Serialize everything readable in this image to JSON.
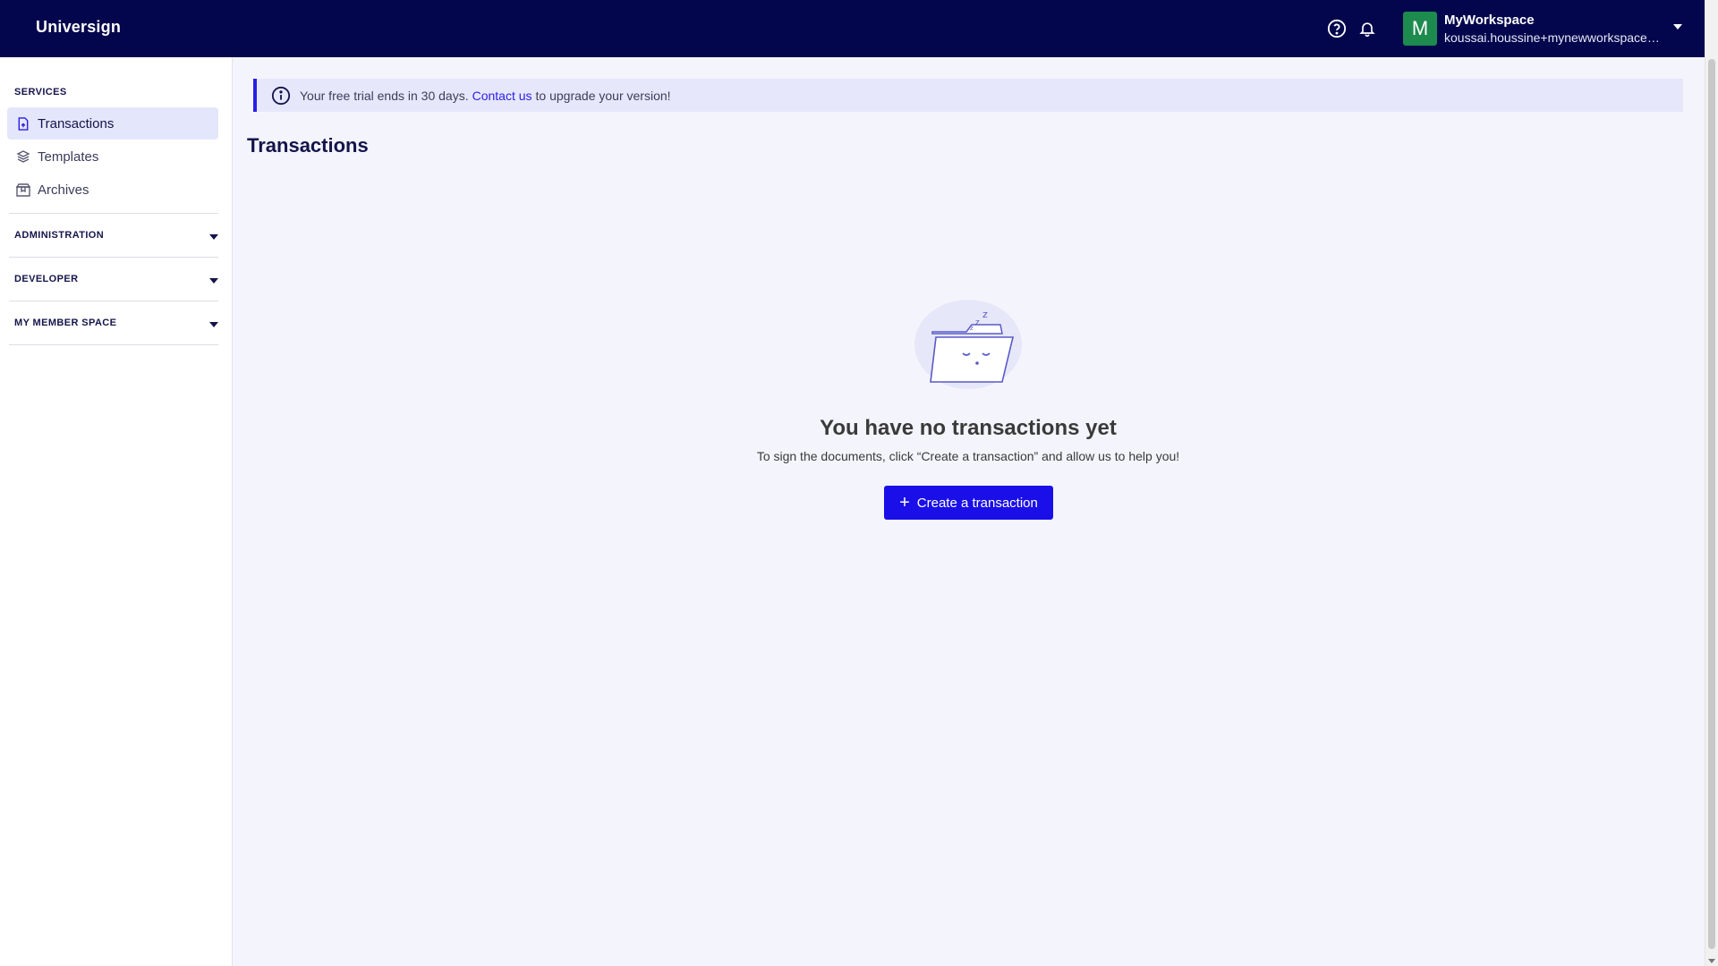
{
  "header": {
    "brand": "Universign",
    "workspace_initial": "M",
    "workspace_name": "MyWorkspace",
    "workspace_email": "koussai.houssine+mynewworkspace@..."
  },
  "sidebar": {
    "services_title": "SERVICES",
    "items": [
      {
        "label": "Transactions",
        "icon": "document-icon"
      },
      {
        "label": "Templates",
        "icon": "layers-icon"
      },
      {
        "label": "Archives",
        "icon": "archive-box-icon"
      }
    ],
    "sections": [
      {
        "label": "ADMINISTRATION"
      },
      {
        "label": "DEVELOPER"
      },
      {
        "label": "MY MEMBER SPACE"
      }
    ]
  },
  "banner": {
    "text_before": "Your free trial ends in 30 days.",
    "link": "Contact us",
    "text_after": "to upgrade your version!"
  },
  "main": {
    "title": "Transactions",
    "empty_title": "You have no transactions yet",
    "empty_description": "To sign the documents, click “Create a transaction” and allow us to help you!",
    "create_button": "Create a transaction"
  },
  "colors": {
    "header_bg": "#03064c",
    "accent": "#1a0fe8",
    "avatar_bg": "#1d8a4e",
    "active_item_bg": "#e4e6fb"
  }
}
